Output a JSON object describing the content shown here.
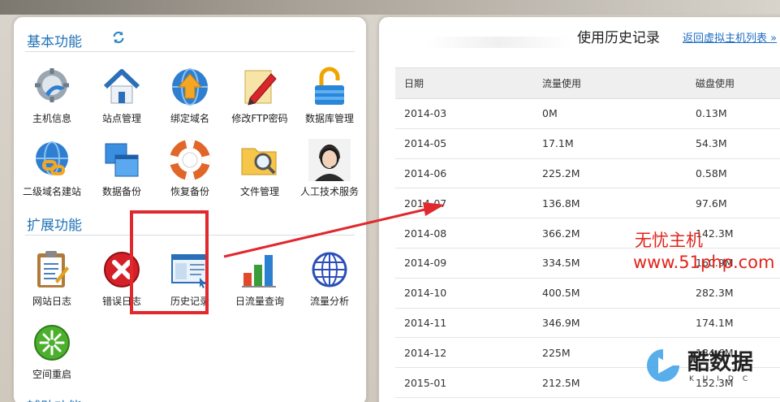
{
  "basic": {
    "title": "基本功能",
    "tiles": [
      {
        "label": "主机信息",
        "icon": "host-info-icon"
      },
      {
        "label": "站点管理",
        "icon": "home-icon"
      },
      {
        "label": "绑定域名",
        "icon": "globe-upload-icon"
      },
      {
        "label": "修改FTP密码",
        "icon": "pencil-icon"
      },
      {
        "label": "数据库管理",
        "icon": "lock-icon"
      },
      {
        "label": "二级域名建站",
        "icon": "globe-link-icon"
      },
      {
        "label": "数据备份",
        "icon": "windows-copy-icon"
      },
      {
        "label": "恢复备份",
        "icon": "lifebuoy-icon"
      },
      {
        "label": "文件管理",
        "icon": "folder-search-icon"
      },
      {
        "label": "人工技术服务",
        "icon": "support-agent-avatar"
      }
    ]
  },
  "extended": {
    "title": "扩展功能",
    "tiles": [
      {
        "label": "网站日志",
        "icon": "clipboard-icon"
      },
      {
        "label": "错误日志",
        "icon": "error-icon"
      },
      {
        "label": "历史记录",
        "icon": "history-window-icon"
      },
      {
        "label": "日流量查询",
        "icon": "bar-chart-icon"
      },
      {
        "label": "流量分析",
        "icon": "globe-grid-icon"
      },
      {
        "label": "空间重启",
        "icon": "restart-icon"
      }
    ]
  },
  "auxiliary": {
    "title": "辅助功能"
  },
  "history": {
    "title": "使用历史记录",
    "back_link": "返回虚拟主机列表 »",
    "columns": [
      "日期",
      "流量使用",
      "磁盘使用"
    ],
    "rows": [
      [
        "2014-03",
        "0M",
        "0.13M"
      ],
      [
        "2014-05",
        "17.1M",
        "54.3M"
      ],
      [
        "2014-06",
        "225.2M",
        "0.58M"
      ],
      [
        "2014-07",
        "136.8M",
        "97.6M"
      ],
      [
        "2014-08",
        "366.2M",
        "142.3M"
      ],
      [
        "2014-09",
        "334.5M",
        "160.9M"
      ],
      [
        "2014-10",
        "400.5M",
        "282.3M"
      ],
      [
        "2014-11",
        "346.9M",
        "174.1M"
      ],
      [
        "2014-12",
        "225M",
        "184.6M"
      ],
      [
        "2015-01",
        "212.5M",
        "152.3M"
      ]
    ]
  },
  "watermarks": {
    "cn": "无忧主机",
    "url": "www.51php.com",
    "logo": "酷数据",
    "logo_sub": "KUIDC"
  },
  "colors": {
    "section_title": "#1f73b7",
    "highlight": "#e0282d",
    "link": "#1f6fc0"
  }
}
